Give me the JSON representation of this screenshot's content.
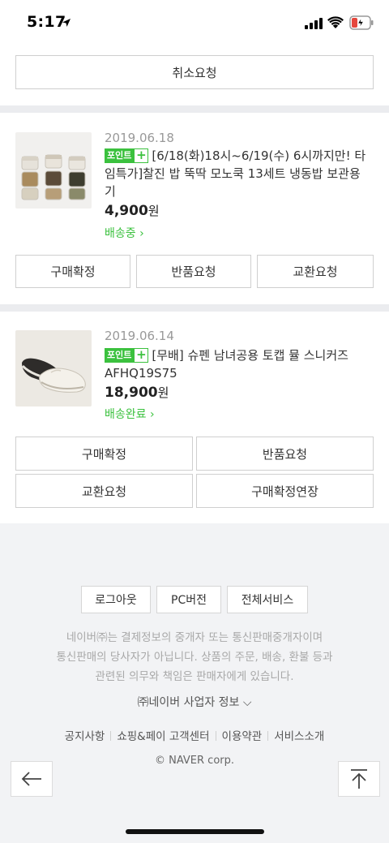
{
  "status": {
    "time": "5:17"
  },
  "top": {
    "cancel_label": "취소요청"
  },
  "orders": [
    {
      "date": "2019.06.18",
      "point_label": "포인트",
      "point_plus": "+",
      "title_line1": "[6/18(화)18시~6/19(수) 6시까지만! 타",
      "title_line2": "임특가]찰진 밥 뚝딱 모노쿡 13세트 냉동밥 보관용",
      "title_line3": "기",
      "price": "4,900",
      "currency": "원",
      "status": "배송중 ›",
      "buttons": [
        "구매확정",
        "반품요청",
        "교환요청"
      ]
    },
    {
      "date": "2019.06.14",
      "point_label": "포인트",
      "point_plus": "+",
      "title_line1": "[무배] 슈펜 남녀공용 토캡 뮬 스니커즈",
      "title_line2": "AFHQ19S75",
      "price": "18,900",
      "currency": "원",
      "status": "배송완료 ›",
      "buttons": [
        "구매확정",
        "반품요청",
        "교환요청",
        "구매확정연장"
      ]
    }
  ],
  "footer": {
    "buttons": [
      "로그아웃",
      "PC버전",
      "전체서비스"
    ],
    "disclaimer_line1": "네이버㈜는 결제정보의 중개자 또는 통신판매중개자이며",
    "disclaimer_line2": "통신판매의 당사자가 아닙니다. 상품의 주문, 배송, 환불 등과",
    "disclaimer_line3": "관련된 의무와 책임은 판매자에게 있습니다.",
    "business_info": "㈜네이버 사업자 정보 ⌵",
    "links": [
      "공지사항",
      "쇼핑&페이 고객센터",
      "이용약관",
      "서비스소개"
    ],
    "copyright": "© NAVER corp."
  },
  "icons": {
    "location": "location-arrow-icon",
    "signal": "cellular-signal-icon",
    "wifi": "wifi-icon",
    "battery": "battery-charging-icon",
    "back": "back-arrow-icon",
    "top": "scroll-top-icon"
  },
  "colors": {
    "accent": "#3bc13e",
    "battery_low": "#e5473d",
    "divider": "#ebecef"
  }
}
